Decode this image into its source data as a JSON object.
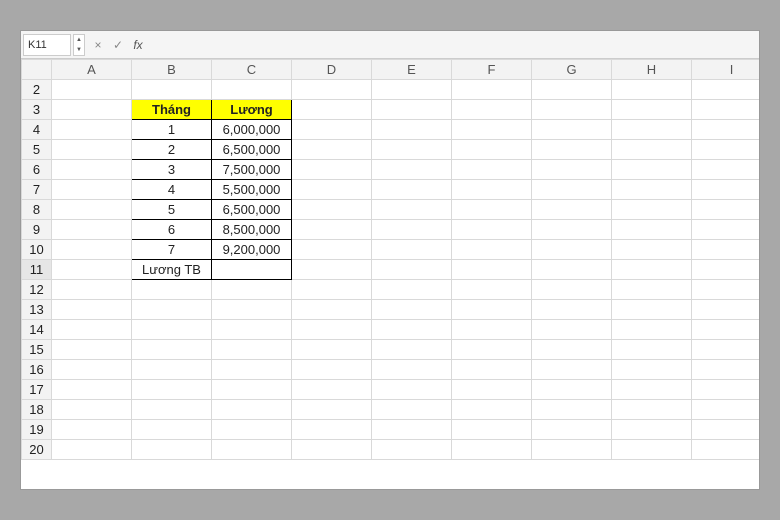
{
  "nameBox": "K11",
  "formulaBar": "",
  "columns": [
    "A",
    "B",
    "C",
    "D",
    "E",
    "F",
    "G",
    "H",
    "I"
  ],
  "rowStart": 2,
  "rowEnd": 20,
  "activeRow": 11,
  "table": {
    "headers": {
      "col1": "Tháng",
      "col2": "Lương"
    },
    "rows": [
      {
        "month": "1",
        "salary": "6,000,000"
      },
      {
        "month": "2",
        "salary": "6,500,000"
      },
      {
        "month": "3",
        "salary": "7,500,000"
      },
      {
        "month": "4",
        "salary": "5,500,000"
      },
      {
        "month": "5",
        "salary": "6,500,000"
      },
      {
        "month": "6",
        "salary": "8,500,000"
      },
      {
        "month": "7",
        "salary": "9,200,000"
      }
    ],
    "footer": {
      "label": "Lương TB",
      "value": ""
    }
  },
  "icons": {
    "cancel": "×",
    "confirm": "✓",
    "fx": "fx",
    "up": "▲",
    "down": "▼"
  }
}
